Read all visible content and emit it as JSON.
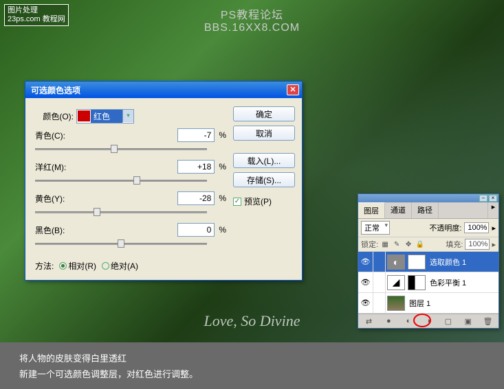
{
  "watermarks": {
    "topleft_line1": "图片处理",
    "topleft_line2": "23ps.com 教程网",
    "top_line1": "PS教程论坛",
    "top_line2": "BBS.16XX8.COM",
    "bottom": "Love, So Divine"
  },
  "dialog": {
    "title": "可选颜色选项",
    "color_label": "颜色(O):",
    "color_value": "红色",
    "sliders": {
      "cyan": {
        "label": "青色(C):",
        "value": "-7",
        "pos": 46
      },
      "magenta": {
        "label": "洋红(M):",
        "value": "+18",
        "pos": 59
      },
      "yellow": {
        "label": "黄色(Y):",
        "value": "-28",
        "pos": 36
      },
      "black": {
        "label": "黑色(B):",
        "value": "0",
        "pos": 50
      }
    },
    "pct": "%",
    "method_label": "方法:",
    "method_rel": "相对(R)",
    "method_abs": "绝对(A)",
    "buttons": {
      "ok": "确定",
      "cancel": "取消",
      "load": "载入(L)...",
      "save": "存储(S)...",
      "preview": "预览(P)"
    }
  },
  "panel": {
    "tabs": {
      "layers": "图层",
      "channels": "通道",
      "paths": "路径"
    },
    "blend": "正常",
    "opacity_label": "不透明度:",
    "opacity_val": "100%",
    "lock_label": "锁定:",
    "fill_label": "填充:",
    "fill_val": "100%",
    "layers": [
      {
        "name": "选取颜色 1",
        "adj": "◐"
      },
      {
        "name": "色彩平衡 1",
        "adj": "▲"
      },
      {
        "name": "图层 1",
        "adj": ""
      }
    ]
  },
  "caption": {
    "line1": "将人物的皮肤变得白里透红",
    "line2": "新建一个可选颜色调整层，对红色进行调整。"
  }
}
